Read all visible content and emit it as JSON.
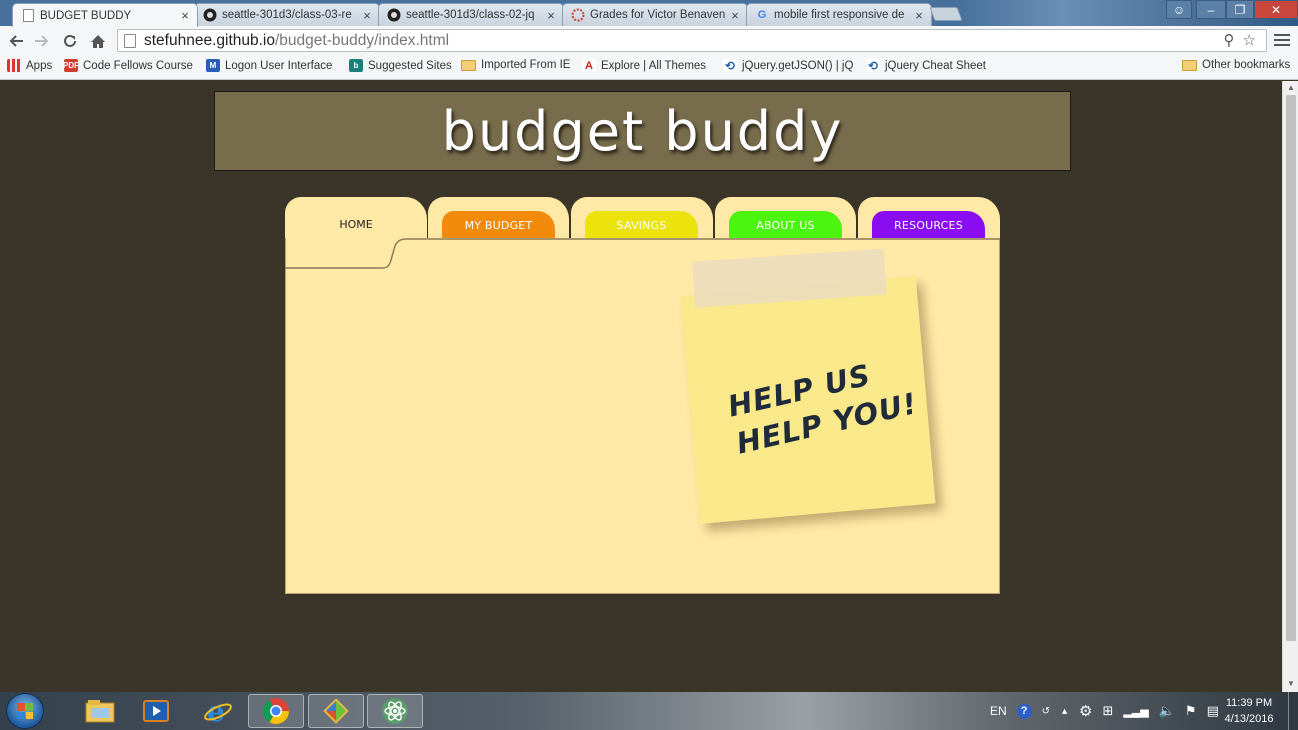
{
  "browser": {
    "tabs": [
      {
        "title": "BUDGET BUDDY",
        "icon": "document-icon",
        "active": true
      },
      {
        "title": "seattle-301d3/class-03-re",
        "icon": "github-icon",
        "active": false
      },
      {
        "title": "seattle-301d3/class-02-jq",
        "icon": "github-icon",
        "active": false
      },
      {
        "title": "Grades for Victor Benaven",
        "icon": "canvas-icon",
        "active": false
      },
      {
        "title": "mobile first responsive de",
        "icon": "google-icon",
        "active": false
      }
    ],
    "tab_close": "×",
    "url_host": "stefuhnee.github.io",
    "url_path": "/budget-buddy/index.html",
    "bookmarks": [
      {
        "label": "Apps",
        "icon": "apps-icon"
      },
      {
        "label": "Code Fellows Course",
        "icon": "pdf-icon"
      },
      {
        "label": "Logon User Interface",
        "icon": "m-icon"
      },
      {
        "label": "Suggested Sites",
        "icon": "bing-icon"
      },
      {
        "label": "Imported From IE",
        "icon": "folder-icon"
      },
      {
        "label": "Explore | All Themes",
        "icon": "adobe-icon"
      },
      {
        "label": "jQuery.getJSON() | jQ",
        "icon": "jquery-icon"
      },
      {
        "label": "jQuery Cheat Sheet",
        "icon": "jquery-icon"
      },
      {
        "label": "Other bookmarks",
        "icon": "folder-icon"
      }
    ]
  },
  "page": {
    "title": "budget buddy",
    "nav": [
      {
        "label": "HOME",
        "color": "#ffe9a6"
      },
      {
        "label": "MY BUDGET",
        "color": "#f28a0b"
      },
      {
        "label": "SAVINGS",
        "color": "#ece20c"
      },
      {
        "label": "ABOUT US",
        "color": "#4cf50f"
      },
      {
        "label": "RESOURCES",
        "color": "#8a0cf0"
      }
    ],
    "sticky_note": {
      "line1": "HELP US",
      "line2": "HELP YOU!"
    },
    "colors": {
      "background": "#3b3428",
      "banner": "#776c4c",
      "folder": "#ffe9a6",
      "sticky": "#f9e98a"
    }
  },
  "taskbar": {
    "language": "EN",
    "time": "11:39 PM",
    "date": "4/13/2016",
    "apps": [
      "file-explorer-icon",
      "media-player-icon",
      "internet-explorer-icon",
      "chrome-icon",
      "git-icon",
      "atom-icon"
    ]
  }
}
